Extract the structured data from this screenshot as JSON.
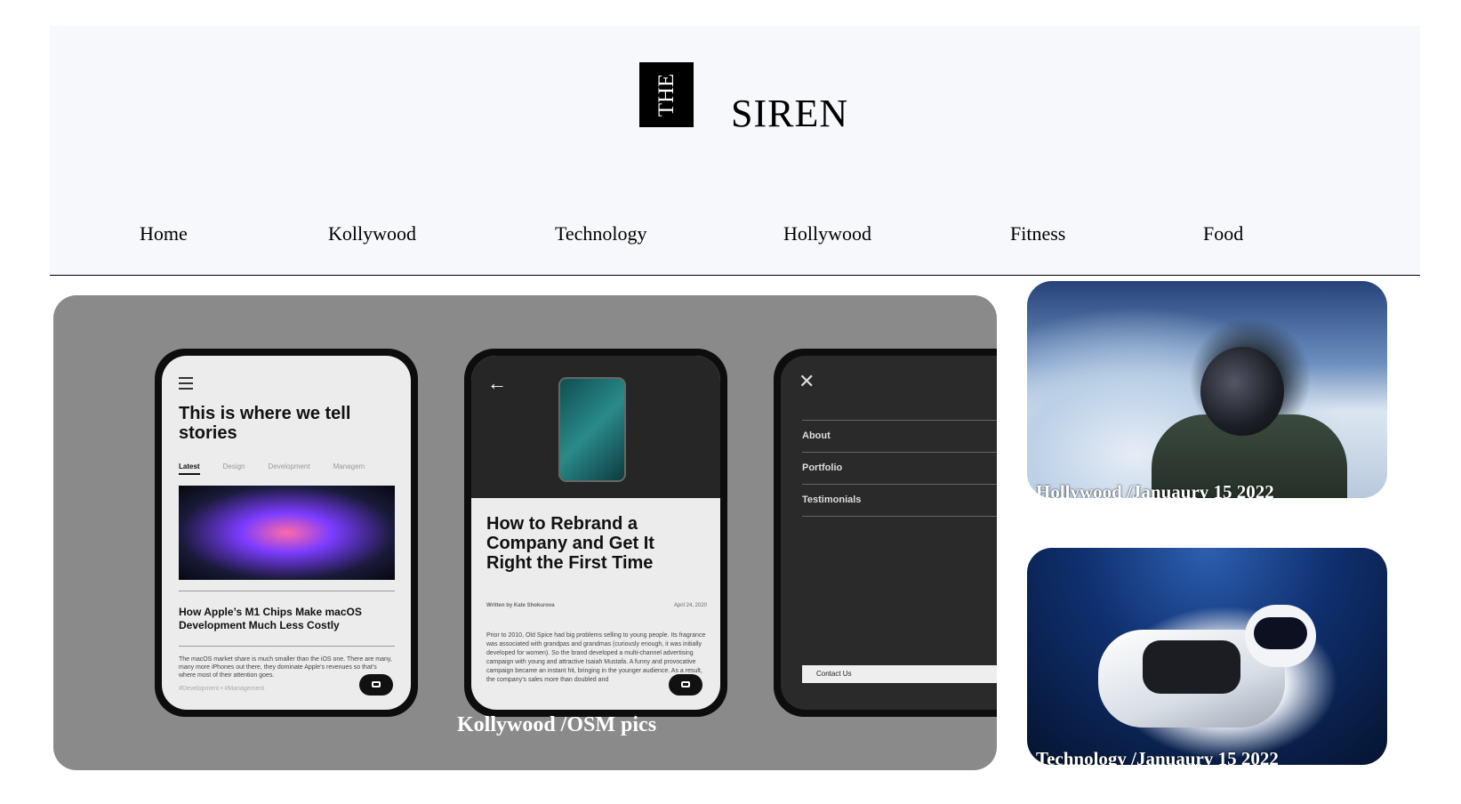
{
  "header": {
    "logo_box_text": "THE",
    "logo_text": "SIREN"
  },
  "nav": {
    "items": [
      "Home",
      "Kollywood",
      "Technology",
      "Hollywood",
      "Fitness",
      "Food"
    ]
  },
  "hero": {
    "caption": "Kollywood /OSM pics",
    "phone1": {
      "heading": "This is where we tell stories",
      "tabs": [
        "Latest",
        "Design",
        "Development",
        "Managem"
      ],
      "article_title": "How Apple’s M1 Chips Make macOS Development Much Less Costly",
      "body": "The macOS market share is much smaller than the iOS one. There are many, many more iPhones out there, they dominate Apple’s revenues so that’s where most of their attention goes.",
      "tags": "#Development  •  #Management"
    },
    "phone2": {
      "title": "How to Rebrand a Company and Get It Right the First Time",
      "author": "Written by Kate Shokurova",
      "date": "April 24, 2020",
      "body": "Prior to 2010, Old Spice had big problems selling to young people. Its fragrance was associated with grandpas and grandmas (curiously enough, it was initially developed for women). So the brand developed a multi-channel advertising campaign with young and attractive Isaiah Mustafa. A funny and provocative campaign became an instant hit, bringing in the younger audience. As a result, the company’s sales more than doubled and"
    },
    "phone3": {
      "menu": [
        "About",
        "Portfolio",
        "Testimonials"
      ],
      "contact": "Contact Us"
    }
  },
  "side_cards": [
    {
      "caption": "Hollywood /Januaury 15 2022"
    },
    {
      "caption": "Technology /Januaury 15 2022"
    }
  ]
}
